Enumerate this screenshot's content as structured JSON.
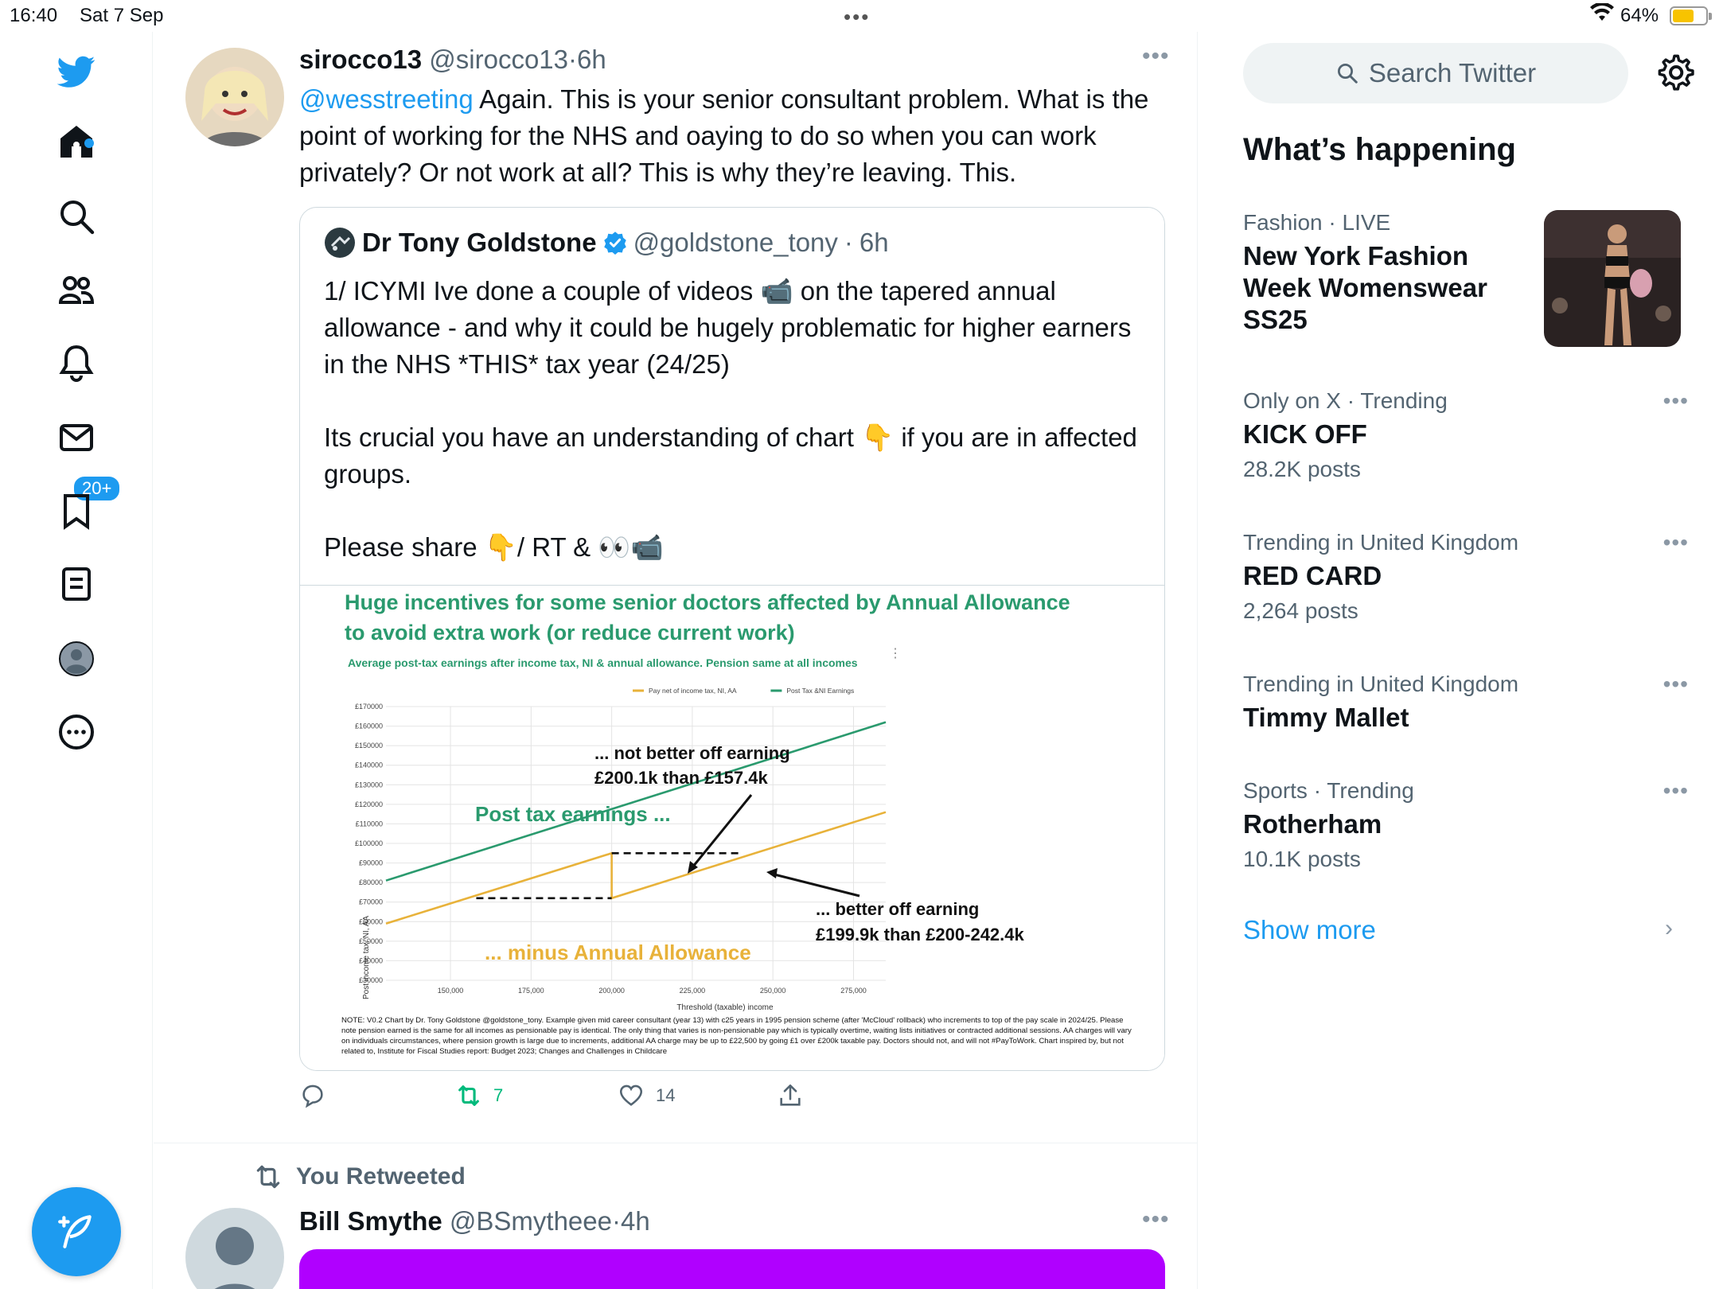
{
  "status_bar": {
    "time": "16:40",
    "date": "Sat 7 Sep",
    "battery": "64%",
    "battery_level": 0.64
  },
  "nav": {
    "notifications_badge": "20+"
  },
  "tweet": {
    "name": "sirocco13",
    "handle": "@sirocco13",
    "separator": "·",
    "time": "6h",
    "mention": "@wesstreeting",
    "text": " Again. This is your senior consultant problem. What is the point of working for the NHS and oaying to do so when you can work privately? Or not work at all? This is why they’re leaving. This."
  },
  "quote": {
    "name": "Dr Tony Goldstone",
    "handle": "@goldstone_tony",
    "separator": "·",
    "time": "6h",
    "text": "1/ ICYMI Ive done a couple of videos 📹 on the tapered annual allowance - and why it could be hugely problematic for higher earners in the NHS *THIS* tax year (24/25)\n\nIts crucial you have an understanding of chart 👇 if you are in affected groups.\n\nPlease share 👇/ RT & 👀📹"
  },
  "chart_data": {
    "type": "line",
    "title": "Huge incentives for some senior doctors affected by Annual Allowance to avoid extra work (or reduce current work)",
    "subtitle": "Average post-tax earnings after income tax, NI & annual allowance. Pension same at all incomes",
    "xlabel": "Threshold (taxable) income",
    "ylabel": "Post income tax, NI, AA",
    "x_ticks": [
      "150,000",
      "175,000",
      "200,000",
      "225,000",
      "250,000",
      "275,000"
    ],
    "y_ticks": [
      "£30000",
      "£40000",
      "£50000",
      "£60000",
      "£70000",
      "£80000",
      "£90000",
      "£100000",
      "£110000",
      "£120000",
      "£130000",
      "£140000",
      "£150000",
      "£160000",
      "£170000"
    ],
    "xlim": [
      130000,
      285000
    ],
    "ylim": [
      30000,
      170000
    ],
    "legend_position": "top",
    "series": [
      {
        "name": "Pay net of income tax, NI, AA",
        "color": "#e8b23a",
        "x": [
          130000,
          200000,
          200000,
          285000
        ],
        "y": [
          59000,
          95000,
          72000,
          116000
        ]
      },
      {
        "name": "Post Tax &NI Earnings",
        "color": "#2a9a6e",
        "x": [
          130000,
          285000
        ],
        "y": [
          81000,
          162000
        ]
      }
    ],
    "reference_lines": [
      {
        "x": [
          158000,
          200000
        ],
        "y": [
          72000,
          72000
        ]
      },
      {
        "x": [
          200000,
          240000
        ],
        "y": [
          95000,
          95000
        ]
      }
    ],
    "annotations": {
      "top": "... not better off earning\n£200.1k than £157.4k",
      "post_tax": "Post tax earnings ...",
      "bottom_right": "... better off earning\n£199.9k than £200-242.4k",
      "minus": "... minus Annual Allowance"
    },
    "note": "NOTE: V0.2 Chart by Dr. Tony Goldstone @goldstone_tony. Example given mid career consultant (year 13) with c25 years in 1995 pension scheme (after 'McCloud' rollback) who increments to top of the pay scale in 2024/25. Please note pension earned is the same for all incomes as pensionable pay is identical. The only thing that varies is non-pensionable pay which is typically overtime, waiting lists initiatives or contracted additional sessions. AA charges will vary on individuals circumstances, where pension growth is large due to increments, additional AA charge may be up to £22,500 by going £1 over £200k taxable pay. Doctors should not, and will not #PayToWork. Chart inspired by, but not related to, Institute for Fiscal Studies report: Budget 2023; Changes and Challenges in Childcare"
  },
  "actions": {
    "retweets": "7",
    "likes": "14"
  },
  "next": {
    "retweeted_label": "You Retweeted",
    "name": "Bill Smythe",
    "handle": "@BSmytheee",
    "separator": "·",
    "time": "4h"
  },
  "sidebar": {
    "search_placeholder": "Search Twitter",
    "title": "What’s happening",
    "trends": [
      {
        "category": "Fashion",
        "meta_suffix": " · LIVE",
        "title": "New York Fashion Week Womenswear SS25",
        "count": ""
      },
      {
        "category": "Only on X · Trending",
        "meta_suffix": "",
        "title": "KICK OFF",
        "count": "28.2K posts"
      },
      {
        "category": "Trending in United Kingdom",
        "meta_suffix": "",
        "title": "RED CARD",
        "count": "2,264 posts"
      },
      {
        "category": "Trending in United Kingdom",
        "meta_suffix": "",
        "title": "Timmy Mallet",
        "count": ""
      },
      {
        "category": "Sports · Trending",
        "meta_suffix": "",
        "title": "Rotherham",
        "count": "10.1K posts"
      }
    ],
    "show_more": "Show more"
  }
}
